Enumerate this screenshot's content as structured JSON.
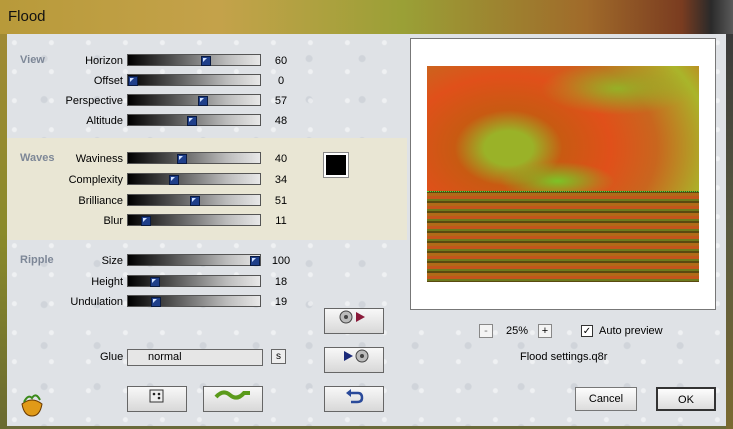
{
  "window": {
    "title": "Flood"
  },
  "sections": {
    "view": "View",
    "waves": "Waves",
    "ripple": "Ripple"
  },
  "sliders": [
    {
      "label": "Horizon",
      "value": "60",
      "fraction": 0.6
    },
    {
      "label": "Offset",
      "value": "0",
      "fraction": 0.0
    },
    {
      "label": "Perspective",
      "value": "57",
      "fraction": 0.57
    },
    {
      "label": "Altitude",
      "value": "48",
      "fraction": 0.48
    },
    {
      "label": "Waviness",
      "value": "40",
      "fraction": 0.4
    },
    {
      "label": "Complexity",
      "value": "34",
      "fraction": 0.34
    },
    {
      "label": "Brilliance",
      "value": "51",
      "fraction": 0.51
    },
    {
      "label": "Blur",
      "value": "11",
      "fraction": 0.11
    },
    {
      "label": "Size",
      "value": "100",
      "fraction": 1.0
    },
    {
      "label": "Height",
      "value": "18",
      "fraction": 0.18
    },
    {
      "label": "Undulation",
      "value": "19",
      "fraction": 0.19
    }
  ],
  "wave_color": "#000000",
  "glue": {
    "label": "Glue",
    "value": "normal",
    "button": "s"
  },
  "preview": {
    "zoom_minus": "-",
    "zoom": "25%",
    "zoom_plus": "+",
    "auto_preview_label": "Auto preview",
    "auto_preview_checked": true,
    "auto_preview_mark": "✓",
    "settings_file": "Flood settings.q8r"
  },
  "buttons": {
    "cancel": "Cancel",
    "ok": "OK"
  },
  "icons": {
    "logo": "flood-logo-icon",
    "dice": "dice-icon",
    "wave": "wave-icon",
    "undo": "undo-icon",
    "load": "load-settings-icon",
    "save": "save-settings-icon"
  }
}
